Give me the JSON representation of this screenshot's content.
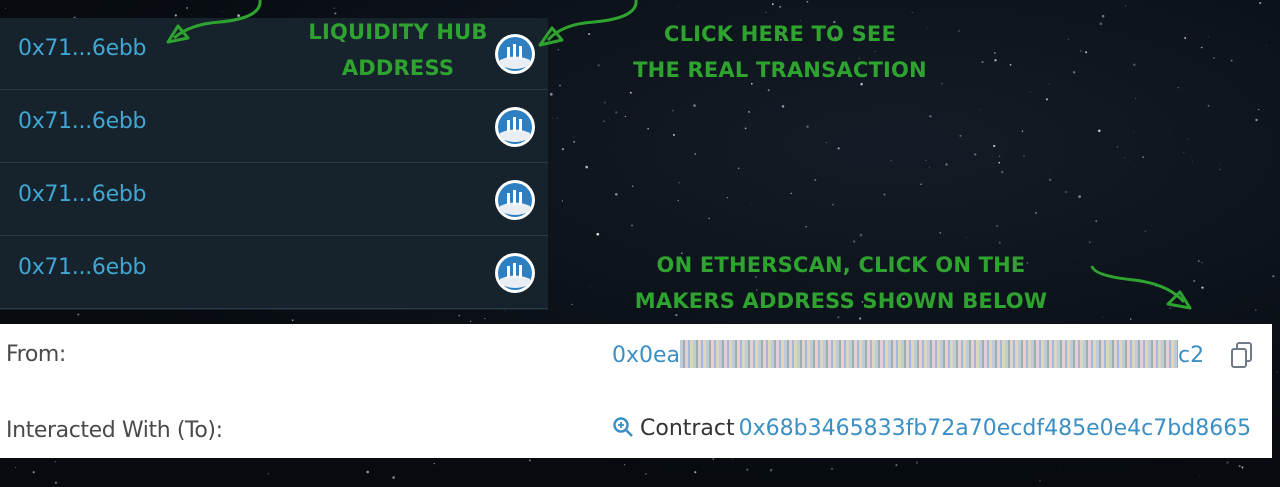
{
  "transactions": {
    "rows": [
      {
        "address": "0x71...6ebb",
        "token_icon": "uniswap-token-icon"
      },
      {
        "address": "0x71...6ebb",
        "token_icon": "uniswap-token-icon"
      },
      {
        "address": "0x71...6ebb",
        "token_icon": "uniswap-token-icon"
      },
      {
        "address": "0x71...6ebb",
        "token_icon": "uniswap-token-icon"
      }
    ]
  },
  "annotations": {
    "hub_line1": "LIQUIDITY HUB",
    "hub_line2": "ADDRESS",
    "click_line1": "CLICK HERE TO SEE",
    "click_line2": "THE REAL TRANSACTION",
    "ether_line1": "ON ETHERSCAN, CLICK ON THE",
    "ether_line2": "MAKERS ADDRESS SHOWN BELOW",
    "color": "#2fa32f"
  },
  "etherscan": {
    "from_label": "From:",
    "from_prefix": "0x0ea",
    "from_suffix": "c2",
    "to_label": "Interacted With (To):",
    "to_kind": "Contract",
    "to_address": "0x68b3465833fb72a70ecdf485e0e4c7bd8665",
    "link_color": "#3b8fc4"
  }
}
